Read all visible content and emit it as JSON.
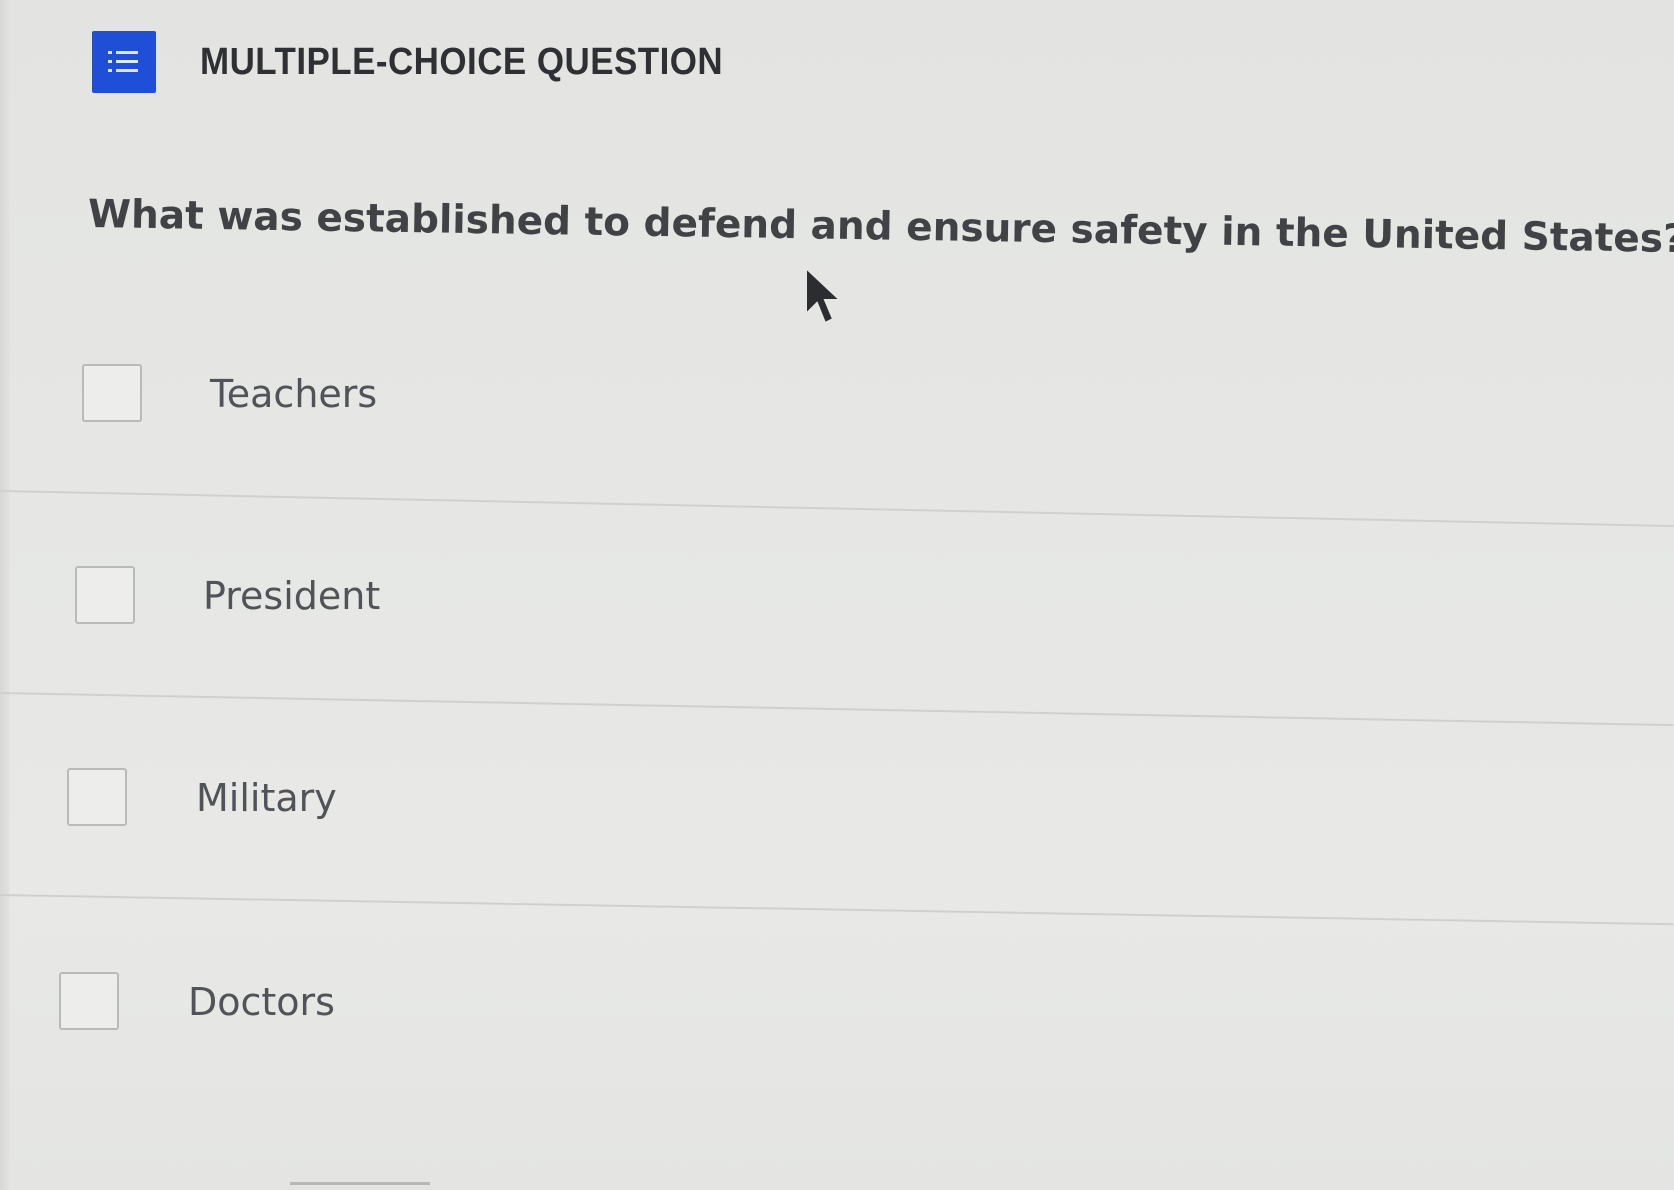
{
  "header": {
    "icon": "list-bullets-icon",
    "title": "MULTIPLE-CHOICE QUESTION",
    "accent_color": "#1f4fd6"
  },
  "question": {
    "text": "What was established to defend and ensure safety in the United States?"
  },
  "options": [
    {
      "label": "Teachers",
      "checked": false
    },
    {
      "label": "President",
      "checked": false
    },
    {
      "label": "Military",
      "checked": false
    },
    {
      "label": "Doctors",
      "checked": false
    }
  ]
}
